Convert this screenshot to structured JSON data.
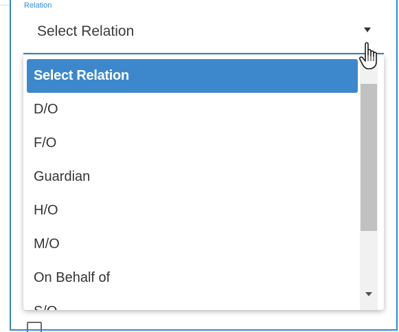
{
  "field": {
    "label": "Relation",
    "value": "Select Relation"
  },
  "dropdown": {
    "options": [
      {
        "label": "Select Relation",
        "selected": true
      },
      {
        "label": "D/O",
        "selected": false
      },
      {
        "label": "F/O",
        "selected": false
      },
      {
        "label": "Guardian",
        "selected": false
      },
      {
        "label": "H/O",
        "selected": false
      },
      {
        "label": "M/O",
        "selected": false
      },
      {
        "label": "On Behalf of",
        "selected": false
      },
      {
        "label": "S/O",
        "selected": false
      }
    ]
  },
  "colors": {
    "accent": "#2b8ad6",
    "selected_bg": "#3d88cc"
  },
  "icons": {
    "field_arrow": "caret-down-icon",
    "cursor": "hand-pointer-icon"
  }
}
